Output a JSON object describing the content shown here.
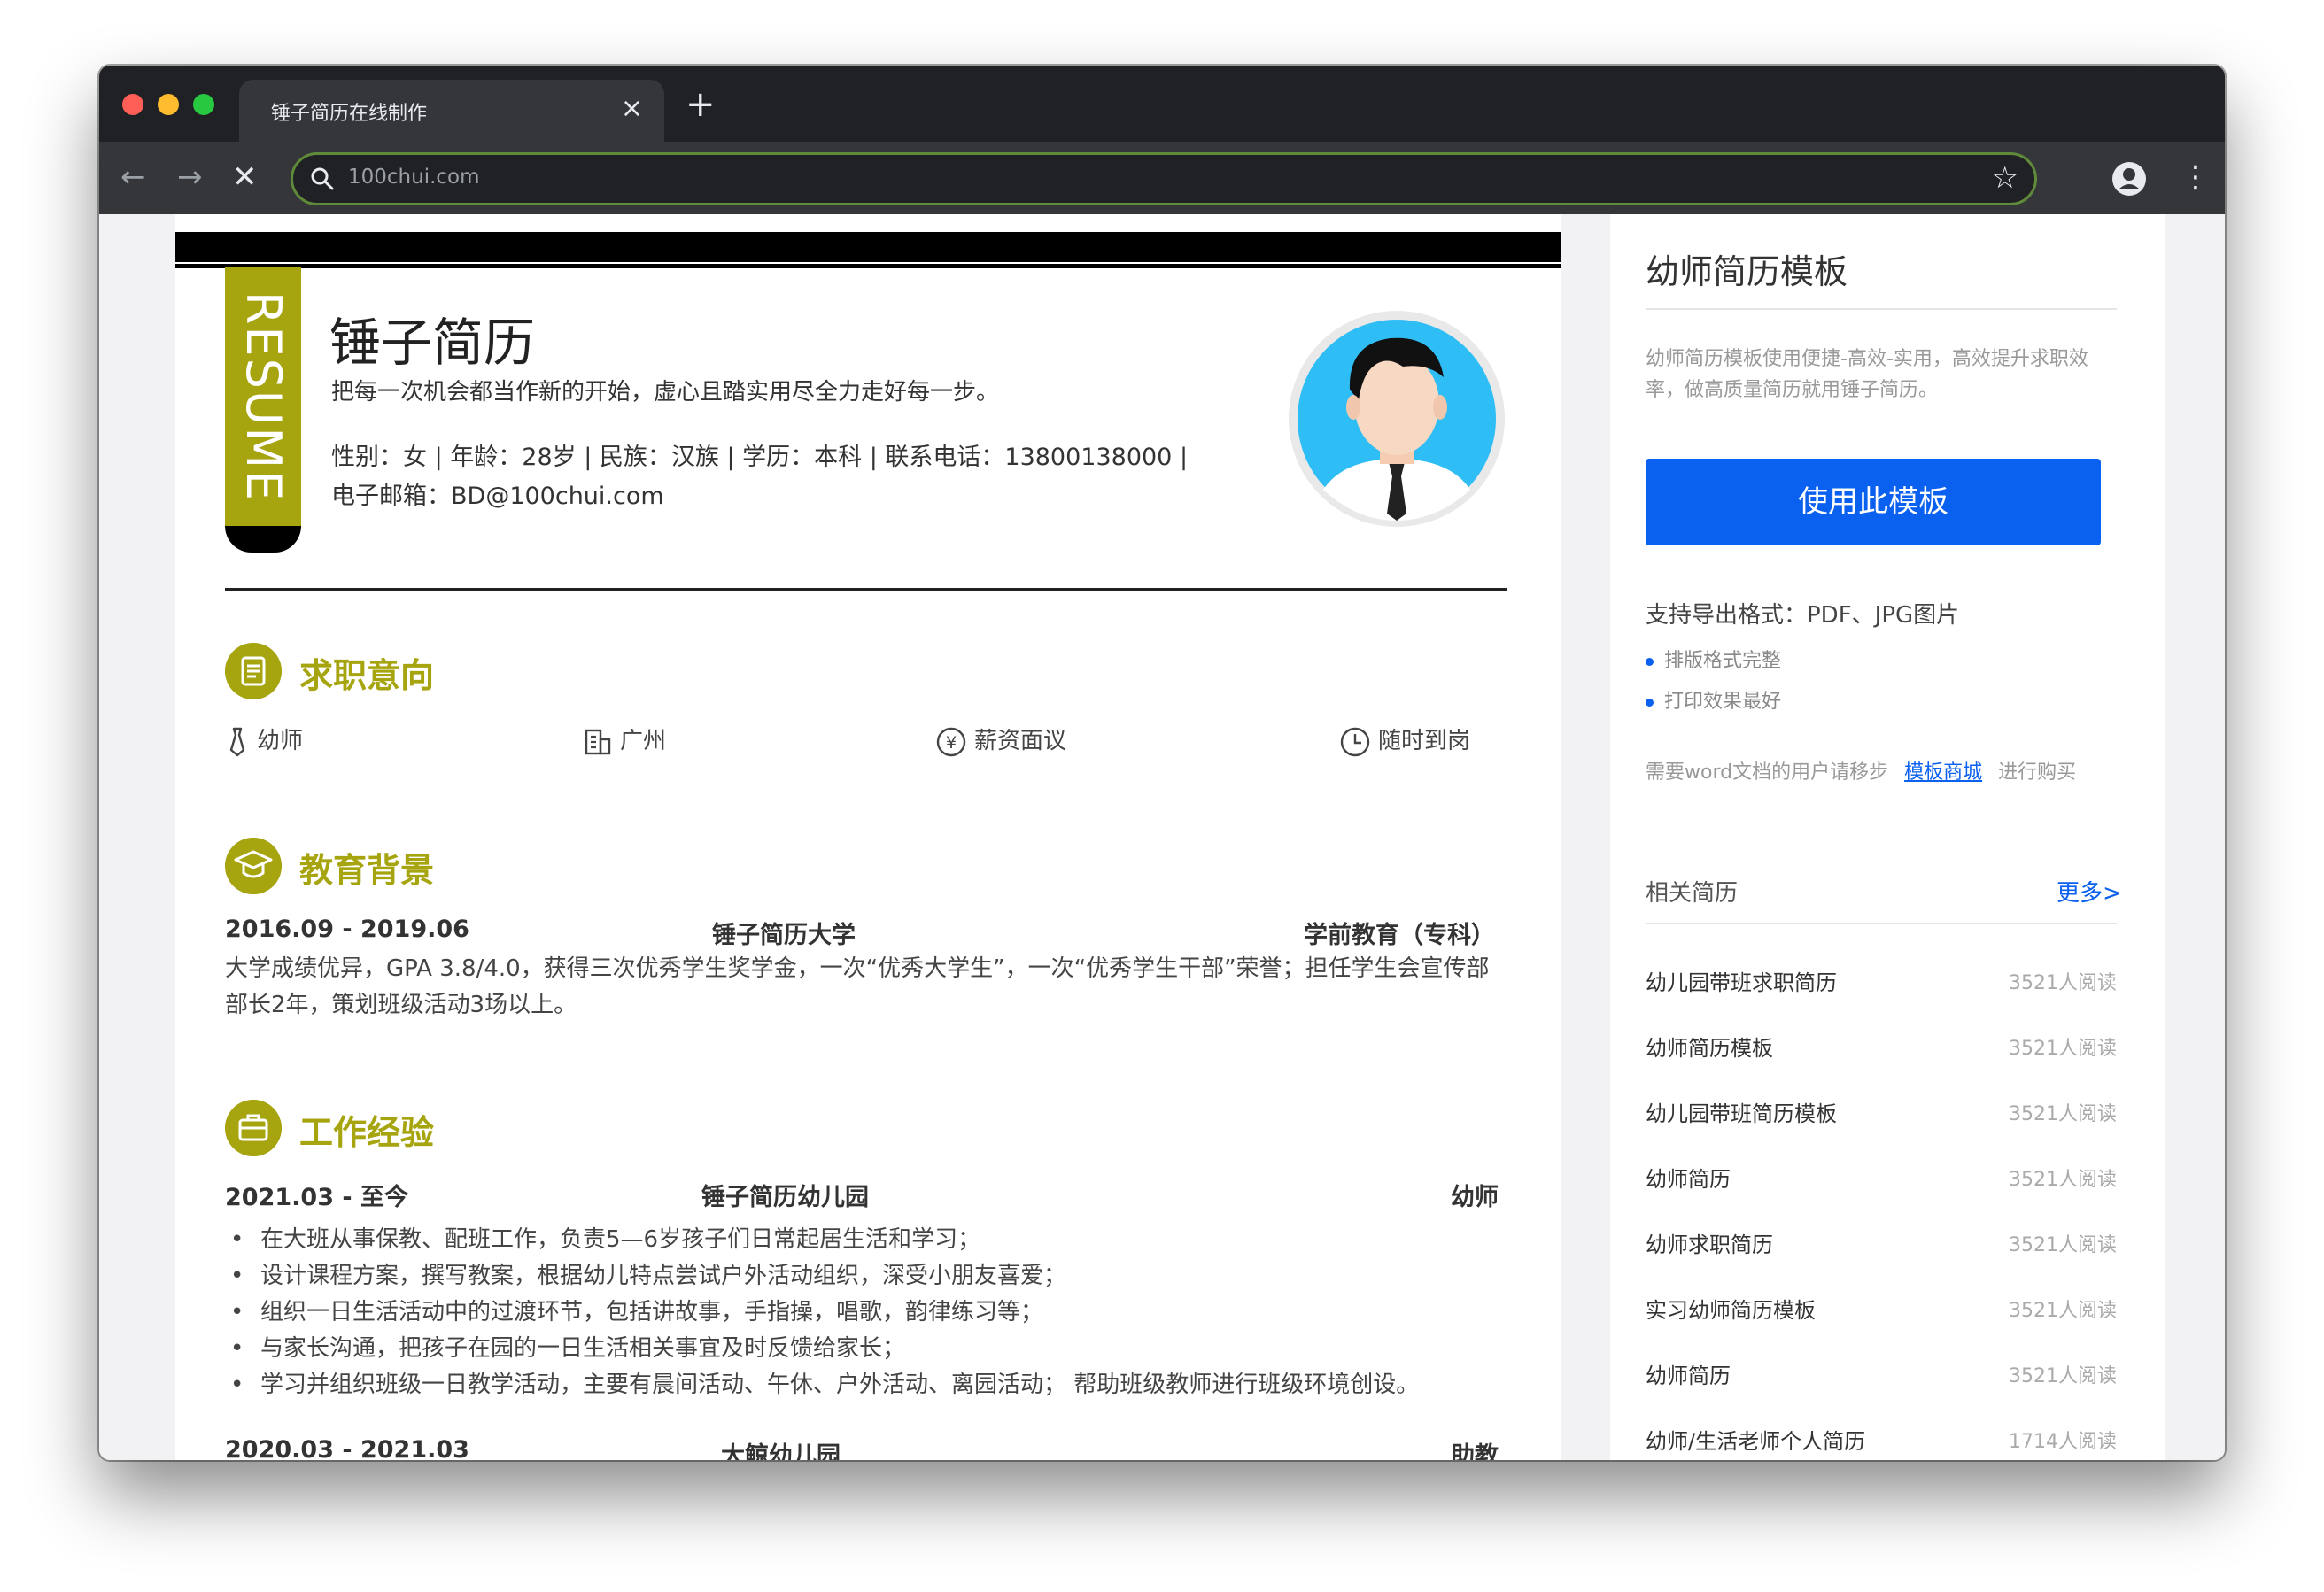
{
  "browser": {
    "tab_title": "锤子简历在线制作",
    "tab_close": "×",
    "new_tab": "+",
    "back": "←",
    "forward": "→",
    "stop": "✕",
    "url": "100chui.com",
    "star": "☆",
    "menu": "⋮"
  },
  "resume": {
    "banner": "RESUME",
    "name": "锤子简历",
    "motto": "把每一次机会都当作新的开始，虚心且踏实用尽全力走好每一步。",
    "info_line": "性别：女 | 年龄：28岁 | 民族：汉族 | 学历：本科 | 联系电话：13800138000 |",
    "email_line": "电子邮箱：BD@100chui.com",
    "sections": {
      "job": "求职意向",
      "education": "教育背景",
      "work": "工作经验"
    },
    "job_items": {
      "position": "幼师",
      "city": "广州",
      "salary": "薪资面议",
      "availability": "随时到岗"
    },
    "education": {
      "period": "2016.09 - 2019.06",
      "school": "锤子简历大学",
      "major": "学前教育（专科）",
      "description": "大学成绩优异，GPA 3.8/4.0，获得三次优秀学生奖学金，一次“优秀大学生”，一次“优秀学生干部”荣誉；担任学生会宣传部部长2年，策划班级活动3场以上。"
    },
    "work": [
      {
        "period": "2021.03 - 至今",
        "company": "锤子简历幼儿园",
        "role": "幼师",
        "bullets": [
          "在大班从事保教、配班工作，负责5—6岁孩子们日常起居生活和学习；",
          "设计课程方案，撰写教案，根据幼儿特点尝试户外活动组织，深受小朋友喜爱；",
          "组织一日生活活动中的过渡环节，包括讲故事，手指操，唱歌，韵律练习等；",
          "与家长沟通，把孩子在园的一日生活相关事宜及时反馈给家长；",
          "学习并组织班级一日教学活动，主要有晨间活动、午休、户外活动、离园活动； 帮助班级教师进行班级环境创设。"
        ]
      },
      {
        "period": "2020.03 - 2021.03",
        "company": "大鲸幼儿园",
        "role": "助教"
      }
    ]
  },
  "sidebar": {
    "title": "幼师简历模板",
    "description": "幼师简历模板使用便捷-高效-实用，高效提升求职效率，做高质量简历就用锤子简历。",
    "use_button": "使用此模板",
    "export_title": "支持导出格式：PDF、JPG图片",
    "features": [
      "排版格式完整",
      "打印效果最好"
    ],
    "word_prefix": "需要word文档的用户请移步",
    "word_link": "模板商城",
    "word_suffix": "进行购买",
    "related_title": "相关简历",
    "more": "更多>",
    "related": [
      {
        "title": "幼儿园带班求职简历",
        "reads": "3521人阅读"
      },
      {
        "title": "幼师简历模板",
        "reads": "3521人阅读"
      },
      {
        "title": "幼儿园带班简历模板",
        "reads": "3521人阅读"
      },
      {
        "title": "幼师简历",
        "reads": "3521人阅读"
      },
      {
        "title": "幼师求职简历",
        "reads": "3521人阅读"
      },
      {
        "title": "实习幼师简历模板",
        "reads": "3521人阅读"
      },
      {
        "title": "幼师简历",
        "reads": "3521人阅读"
      },
      {
        "title": "幼师/生活老师个人简历",
        "reads": "1714人阅读"
      }
    ]
  }
}
